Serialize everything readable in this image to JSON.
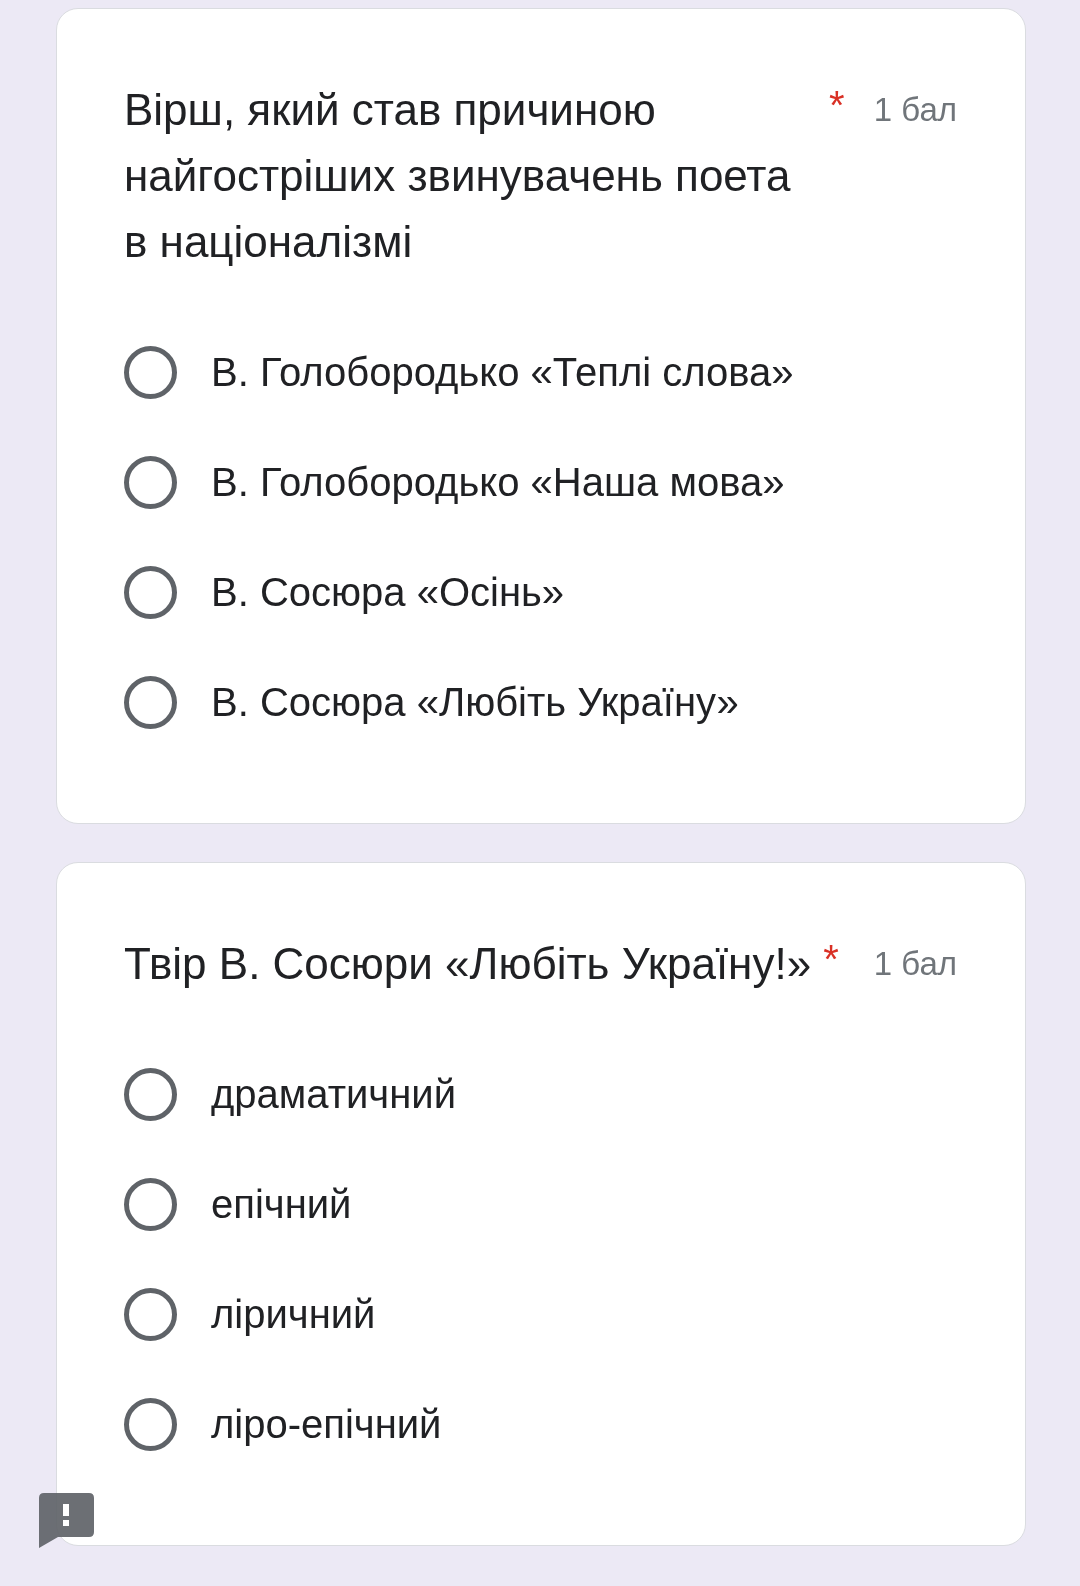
{
  "questions": [
    {
      "title": "Вірш, який став причиною найгостріших звинувачень поета в націоналізмі",
      "required_mark": "*",
      "points": "1 бал",
      "options": [
        {
          "label": "В. Голобородько «Теплі слова»",
          "selected": false
        },
        {
          "label": "В. Голобородько «Наша мова»",
          "selected": false
        },
        {
          "label": "В. Сосюра «Осінь»",
          "selected": false
        },
        {
          "label": "В. Сосюра «Любіть Україну»",
          "selected": false
        }
      ]
    },
    {
      "title": "Твір В. Сосюри «Любіть Україну!»",
      "required_mark": "*",
      "points": "1 бал",
      "options": [
        {
          "label": "драматичний",
          "selected": false
        },
        {
          "label": "епічний",
          "selected": false
        },
        {
          "label": "ліричний",
          "selected": false
        },
        {
          "label": "ліро-епічний",
          "selected": false
        }
      ]
    }
  ]
}
